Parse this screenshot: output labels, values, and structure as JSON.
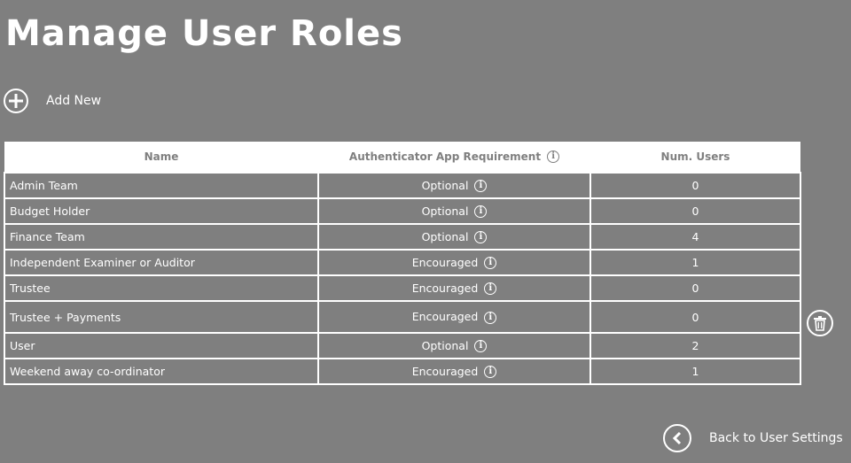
{
  "page": {
    "title": "Manage User Roles"
  },
  "actions": {
    "add_new_label": "Add New",
    "back_label": "Back to User Settings"
  },
  "table": {
    "columns": [
      "Name",
      "Authenticator App Requirement",
      "Num. Users"
    ],
    "rows": [
      {
        "name": "Admin Team",
        "requirement": "Optional",
        "num_users": "0"
      },
      {
        "name": "Budget Holder",
        "requirement": "Optional",
        "num_users": "0"
      },
      {
        "name": "Finance Team",
        "requirement": "Optional",
        "num_users": "4"
      },
      {
        "name": "Independent Examiner or Auditor",
        "requirement": "Encouraged",
        "num_users": "1"
      },
      {
        "name": "Trustee",
        "requirement": "Encouraged",
        "num_users": "0"
      },
      {
        "name": "Trustee + Payments",
        "requirement": "Encouraged",
        "num_users": "0"
      },
      {
        "name": "User",
        "requirement": "Optional",
        "num_users": "2"
      },
      {
        "name": "Weekend away co-ordinator",
        "requirement": "Encouraged",
        "num_users": "1"
      }
    ]
  },
  "colors": {
    "background": "#7f7f7f",
    "foreground": "#ffffff"
  },
  "icons": {
    "add": "plus-circle-icon",
    "info": "info-icon",
    "delete": "trash-icon",
    "back": "chevron-left-icon"
  }
}
